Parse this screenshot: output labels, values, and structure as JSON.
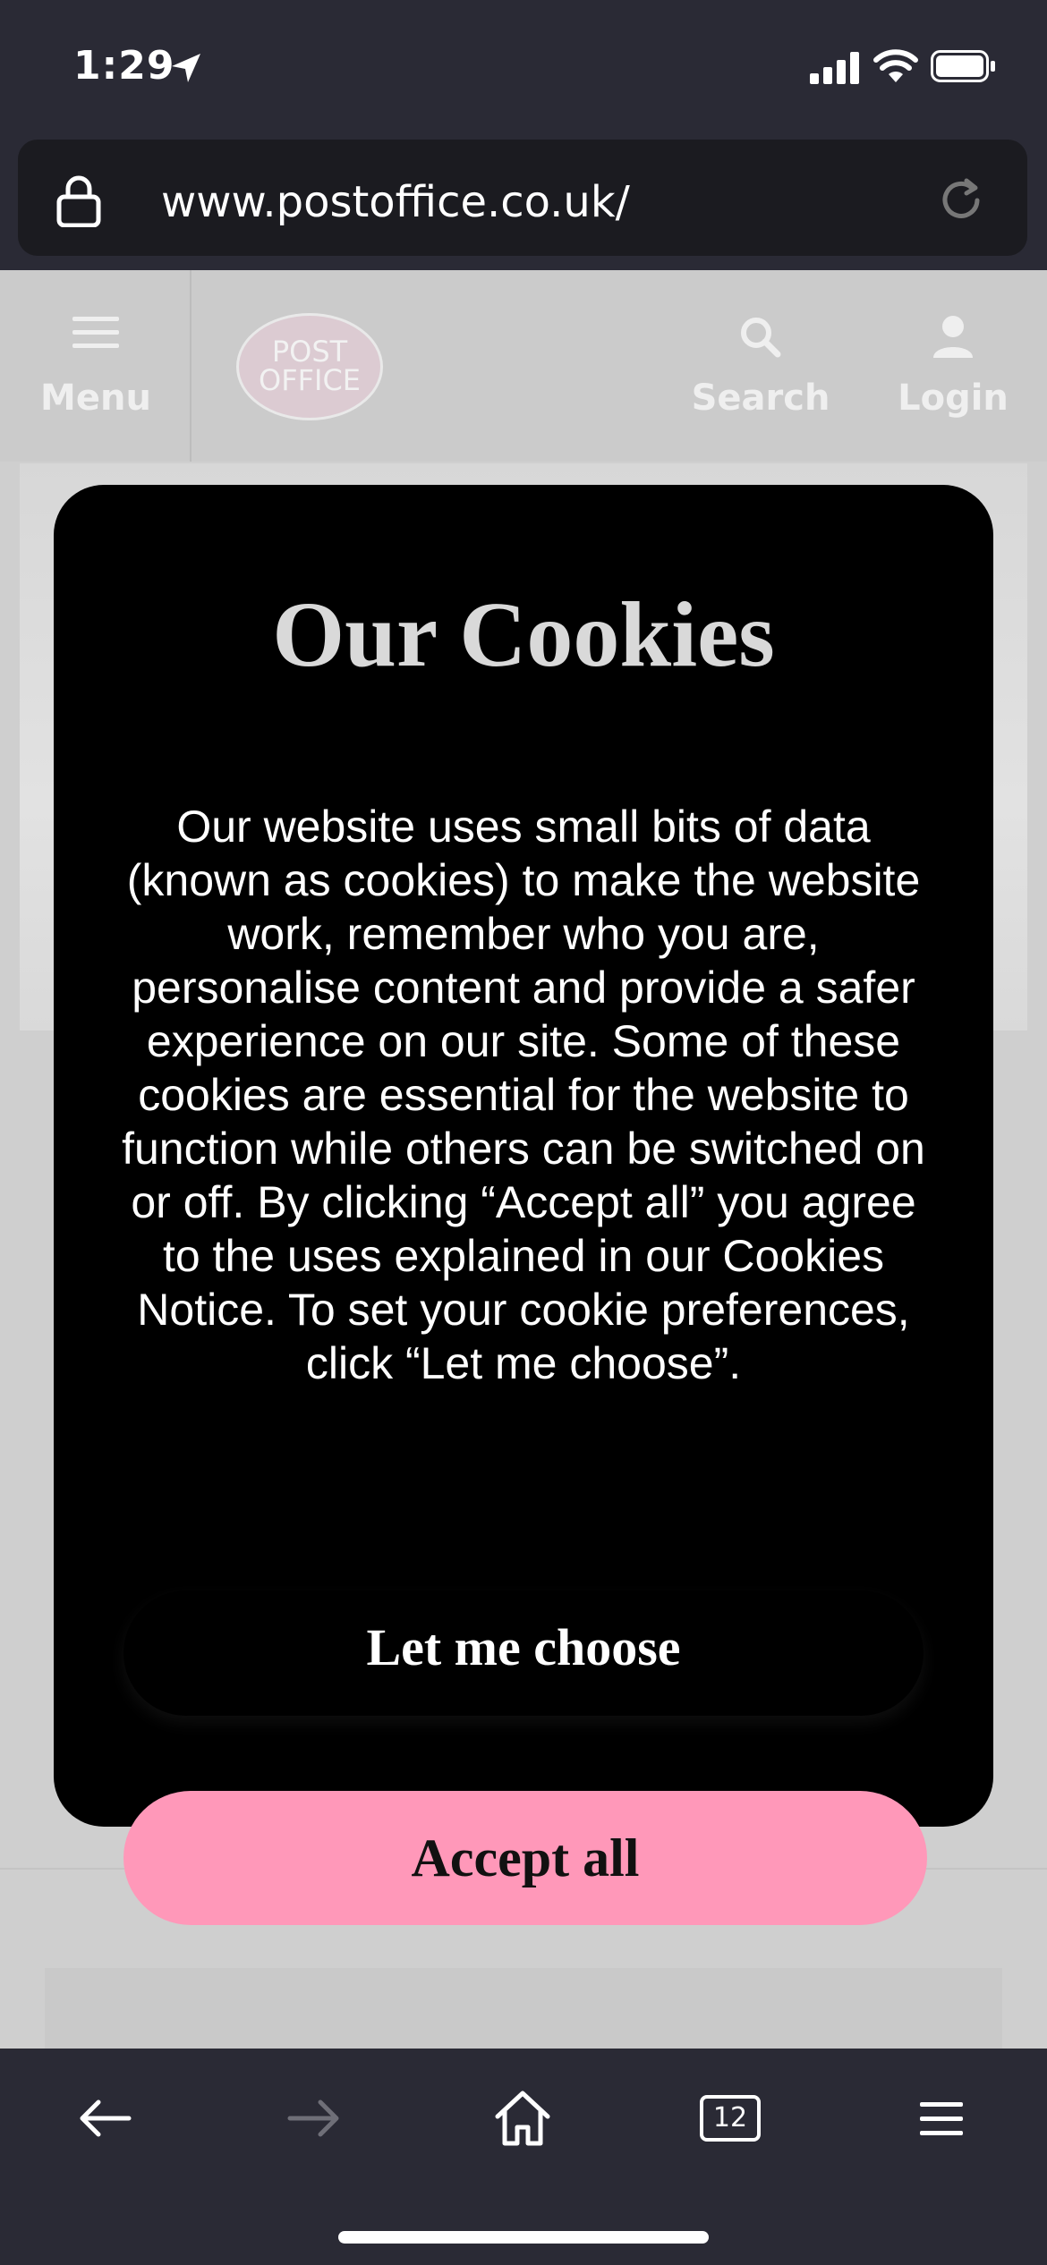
{
  "status_bar": {
    "time": "1:29"
  },
  "browser": {
    "url": "www.postoffice.co.uk/"
  },
  "header": {
    "menu_label": "Menu",
    "logo_line1": "POST",
    "logo_line2": "OFFICE",
    "search_label": "Search",
    "login_label": "Login"
  },
  "modal": {
    "title": "Our Cookies",
    "body": "Our website uses small bits of data (known as cookies) to make the website work, remember who you are, personalise content and provide a safer experience on our site. Some of these cookies are essential for the website to function while others can be switched on or off. By clicking “Accept all” you agree to the uses explained in our Cookies Notice. To set your cookie preferences, click “Let me choose”.",
    "choose_label": "Let me choose",
    "accept_label": "Accept all"
  },
  "toolbar": {
    "tab_count": "12"
  },
  "colors": {
    "accent": "#ff98b9",
    "chrome": "#2a2a35",
    "modal": "#000000"
  },
  "icons": [
    "location-arrow-icon",
    "signal-icon",
    "wifi-icon",
    "battery-icon",
    "lock-icon",
    "reload-icon",
    "hamburger-icon",
    "search-icon",
    "user-icon",
    "back-arrow-icon",
    "forward-arrow-icon",
    "home-icon",
    "tabs-icon",
    "menu-icon"
  ]
}
